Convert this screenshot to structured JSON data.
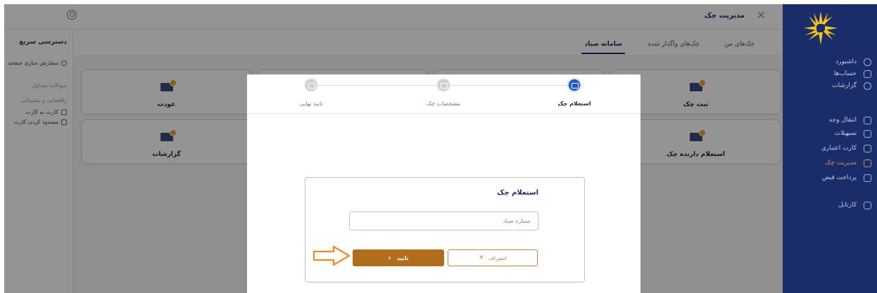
{
  "sidebar": {
    "items": [
      {
        "label": "داشبورد",
        "icon": "dashboard-icon"
      },
      {
        "label": "حساب‌ها",
        "icon": "bank-icon"
      },
      {
        "label": "گزارشات",
        "icon": "report-icon"
      },
      {
        "label": "انتقال وجه",
        "icon": "transfer-icon"
      },
      {
        "label": "تسهیلات",
        "icon": "loan-icon"
      },
      {
        "label": "کارت اعتباری",
        "icon": "credit-card-icon"
      },
      {
        "label": "مدیریت چک",
        "icon": "cheque-icon"
      },
      {
        "label": "پرداخت قبض",
        "icon": "bill-icon"
      },
      {
        "label": "کارتابل",
        "icon": "briefcase-icon"
      }
    ],
    "active_index": 6
  },
  "header": {
    "title": "مدیریت چک"
  },
  "quick_access": {
    "title": "دسترسی سریع",
    "customize": "سفارش سازی صفحه",
    "faq": "سوالات متداول",
    "support": "راهنمایی و پشتیبانی",
    "card_to_card": "کارت به کارت",
    "block_card": "مسدود کردن کارت"
  },
  "tabs": [
    {
      "label": "چک‌های من"
    },
    {
      "label": "چک‌های واگذار شده"
    },
    {
      "label": "سامانه صیاد"
    }
  ],
  "cards": {
    "register": "ثبت چک",
    "return": "عودت",
    "holder_inquiry": "استعلام دارنده چک",
    "reports": "گزارشات"
  },
  "stepper": {
    "steps": [
      {
        "label": "استعلام چک"
      },
      {
        "label": "مشخصات چک"
      },
      {
        "label": "تایید نهایی"
      }
    ],
    "active_index": 0
  },
  "inquiry": {
    "title": "استعلام چک",
    "input_placeholder": "شماره صیاد",
    "input_value": "",
    "cancel_label": "انصراف",
    "confirm_label": "تایید"
  },
  "colors": {
    "sidebar_bg": "#1b2c6b",
    "accent": "#b06e1c",
    "step_active": "#1f57c3"
  }
}
